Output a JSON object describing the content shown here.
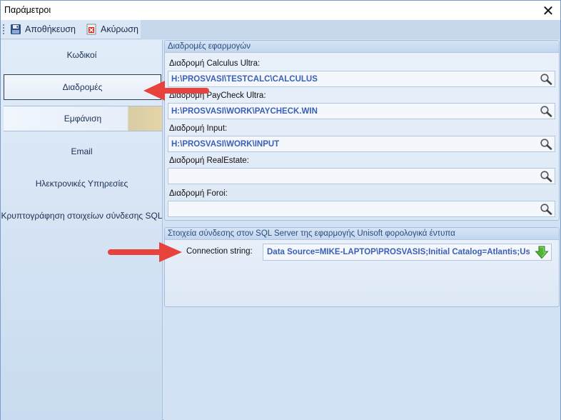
{
  "window": {
    "title": "Παράμετροι",
    "close_glyph": "✕"
  },
  "toolbar": {
    "save_label": "Αποθήκευση",
    "cancel_label": "Ακύρωση"
  },
  "sidebar": {
    "items": [
      {
        "label": "Κωδικοί"
      },
      {
        "label": "Διαδρομές"
      },
      {
        "label": "Εμφάνιση"
      },
      {
        "label": "Email"
      },
      {
        "label": "Ηλεκτρονικές Υπηρεσίες"
      },
      {
        "label": "Κρυπτογράφηση στοιχείων σύνδεσης SQL"
      }
    ]
  },
  "paths": {
    "header": "Διαδρομές εφαρμογών",
    "fields": [
      {
        "label": "Διαδρομή Calculus Ultra:",
        "value": "H:\\PROSVASI\\TESTCALC\\CALCULUS"
      },
      {
        "label": "Διαδρομή PayCheck Ultra:",
        "value": "H:\\PROSVASI\\WORK\\PAYCHECK.WIN"
      },
      {
        "label": "Διαδρομή Input:",
        "value": "H:\\PROSVASI\\WORK\\INPUT"
      },
      {
        "label": "Διαδρομή RealEstate:",
        "value": ""
      },
      {
        "label": "Διαδρομή Foroi:",
        "value": ""
      }
    ]
  },
  "sql": {
    "header": "Στοιχεία σύνδεσης στον SQL Server της εφαρμογής Unisoft φορολογικά έντυπα",
    "conn_label": "Connection string:",
    "conn_value": "Data Source=MIKE-LAPTOP\\PROSVASIS;Initial Catalog=Atlantis;User I"
  },
  "colors": {
    "accent_text": "#3a5fb8",
    "annotation_arrow": "#e8423d"
  },
  "icons": {
    "save": "floppy-disk-icon",
    "cancel": "red-x-document-icon",
    "search": "magnifier-icon",
    "dropdown": "green-down-arrow-icon"
  }
}
